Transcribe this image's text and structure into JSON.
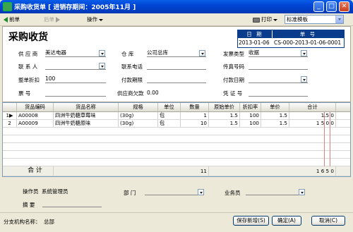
{
  "window": {
    "title": "采购收货单 [ 进销存期间：2005年11月 ]",
    "minimize": "_",
    "maximize": "□",
    "close": "✕"
  },
  "toolbar": {
    "prev": "前单",
    "next": "后单",
    "ops": "操作",
    "print": "打印",
    "template": "标准模板"
  },
  "form": {
    "heading": "采购收货",
    "date_label": "日 期",
    "date_value": "2013-01-06",
    "num_label": "单 号",
    "num_value": "CS-000-2013-01-06-0001",
    "supplier_label": "供 应 商",
    "supplier_value": "美达电器",
    "warehouse_label": "仓    库",
    "warehouse_value": "公司总库",
    "invoice_label": "发票类型",
    "invoice_value": "收据",
    "contact_label": "联 系 人",
    "contact_value": "",
    "phone_label": "联系电话",
    "phone_value": "",
    "fax_label": "传真号码",
    "fax_value": "",
    "discount_label": "整单折扣",
    "discount_value": "100",
    "pay_term_label": "付款期限",
    "pay_term_value": "",
    "pay_date_label": "付款日期",
    "pay_date_value": "",
    "ticket_label": "票    号",
    "ticket_value": "",
    "owed_label": "供应商欠款",
    "owed_value": "0.00",
    "voucher_label": "凭 证 号",
    "voucher_value": ""
  },
  "grid": {
    "columns": [
      "货品编码",
      "货品名称",
      "规格",
      "单位",
      "数量",
      "原始单价",
      "折扣率",
      "单价",
      "合计"
    ],
    "rows": [
      {
        "marker": "1▶",
        "code": "A00008",
        "name": "四洲牛奶糖草莓味",
        "spec": "(30g)",
        "unit": "包",
        "qty": "1",
        "orig_price": "1.5",
        "discount": "100",
        "price": "1.5",
        "total": "1.5 0"
      },
      {
        "marker": "2",
        "code": "A00009",
        "name": "四洲牛奶糖原味",
        "spec": "(30g)",
        "unit": "包",
        "qty": "10",
        "orig_price": "1.5",
        "discount": "100",
        "price": "1.5",
        "total": "1 5 0 0"
      }
    ],
    "sum_label": "合  计",
    "sum_qty": "11",
    "sum_total": "1 6 5 0"
  },
  "footer": {
    "operator_label": "操作员",
    "operator_value": "系统管理员",
    "dept_label": "部    门",
    "clerk_label": "业务员",
    "summary_label": "摘    要",
    "branch_label": "分支机构名称：",
    "branch_value": "总部",
    "save_new": "保存新增(S)",
    "ok": "确定(A)",
    "cancel": "取消(C)"
  }
}
